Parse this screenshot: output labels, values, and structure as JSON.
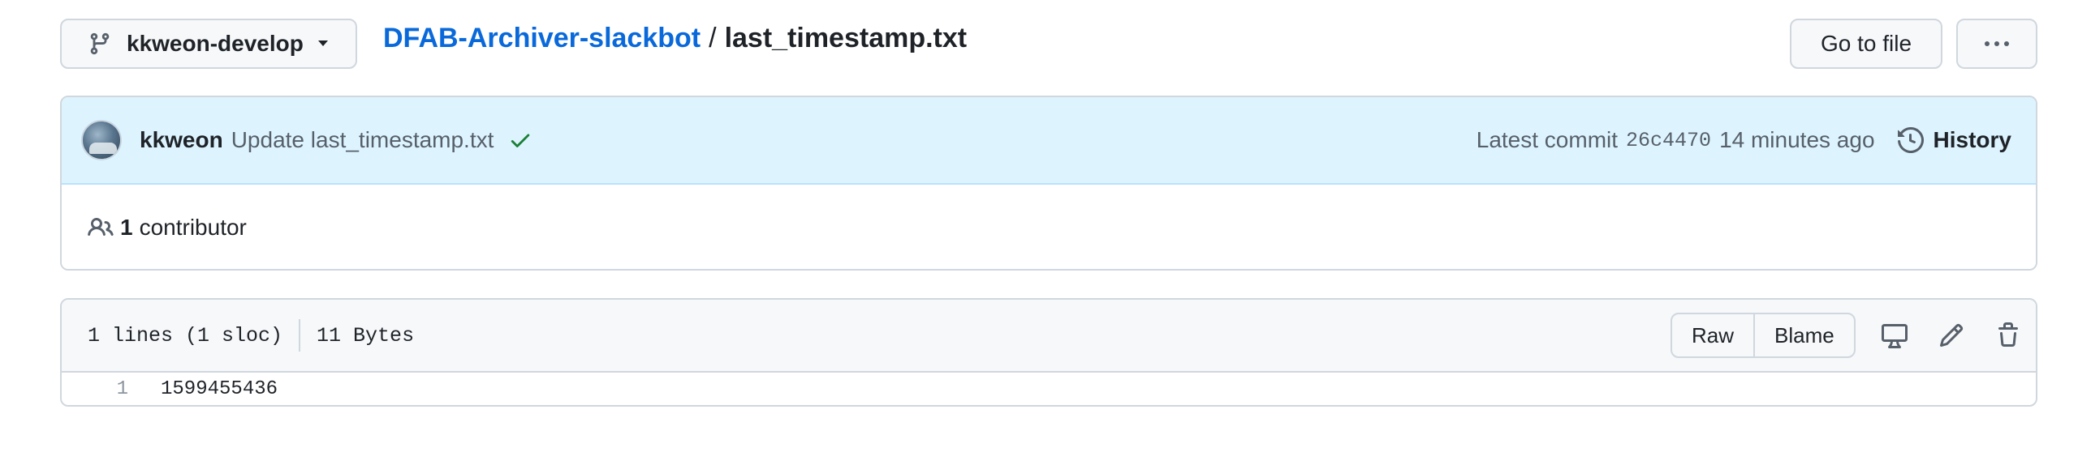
{
  "branch": {
    "name": "kkweon-develop"
  },
  "breadcrumb": {
    "repo": "DFAB-Archiver-slackbot",
    "separator": "/",
    "file": "last_timestamp.txt"
  },
  "actions": {
    "go_to_file": "Go to file"
  },
  "commit": {
    "author": "kkweon",
    "message": "Update last_timestamp.txt",
    "latest_label": "Latest commit",
    "sha": "26c4470",
    "time": "14 minutes ago",
    "history_label": "History",
    "status_color": "#1a7f37"
  },
  "contributors": {
    "count": "1",
    "label": "contributor"
  },
  "file_info": {
    "lines": "1 lines (1 sloc)",
    "size": "11 Bytes",
    "raw_label": "Raw",
    "blame_label": "Blame"
  },
  "code": {
    "lines": [
      {
        "num": "1",
        "text": "1599455436"
      }
    ]
  },
  "colors": {
    "link": "#0969da",
    "commit_bg": "#ddf4ff",
    "border": "#d0d7de"
  }
}
